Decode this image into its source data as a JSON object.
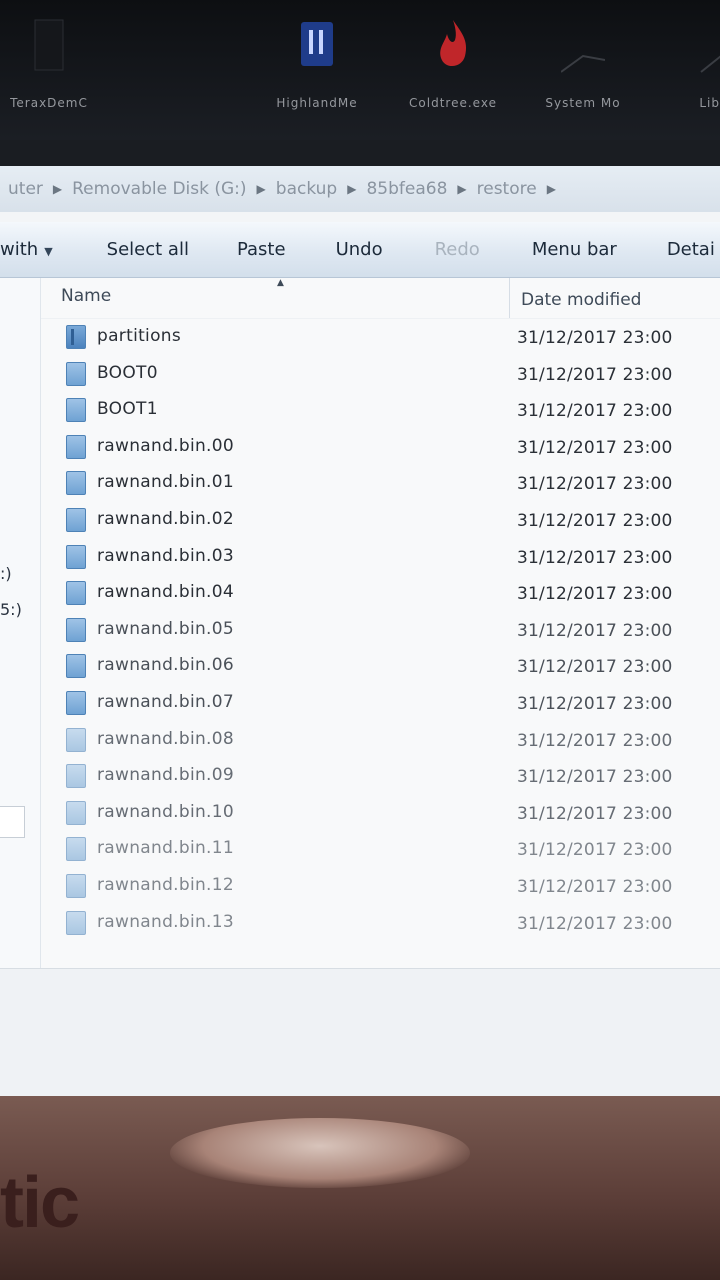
{
  "desktop": {
    "icons": [
      {
        "label": "TeraxDemC",
        "icon": "app-icon"
      },
      {
        "label": "HighlandMe",
        "icon": "app-icon"
      },
      {
        "label": "Coldtree.exe",
        "icon": "flame-icon"
      },
      {
        "label": "System Mo",
        "icon": "app-icon"
      },
      {
        "label": "LibHu",
        "icon": "app-icon"
      }
    ]
  },
  "address": {
    "crumbs": [
      "uter",
      "Removable Disk (G:)",
      "backup",
      "85bfea68",
      "restore"
    ]
  },
  "toolbar": {
    "open_with": "with",
    "select_all": "Select all",
    "paste": "Paste",
    "undo": "Undo",
    "redo": "Redo",
    "menu_bar": "Menu bar",
    "details": "Detai"
  },
  "navpane": {
    "frag1": ":)",
    "frag2": "5:)"
  },
  "list": {
    "columns": {
      "name": "Name",
      "date": "Date modified"
    },
    "files": [
      {
        "name": "partitions",
        "date": "31/12/2017 23:00",
        "type": "folder"
      },
      {
        "name": "BOOT0",
        "date": "31/12/2017 23:00",
        "type": "file"
      },
      {
        "name": "BOOT1",
        "date": "31/12/2017 23:00",
        "type": "file"
      },
      {
        "name": "rawnand.bin.00",
        "date": "31/12/2017 23:00",
        "type": "file"
      },
      {
        "name": "rawnand.bin.01",
        "date": "31/12/2017 23:00",
        "type": "file"
      },
      {
        "name": "rawnand.bin.02",
        "date": "31/12/2017 23:00",
        "type": "file"
      },
      {
        "name": "rawnand.bin.03",
        "date": "31/12/2017 23:00",
        "type": "file"
      },
      {
        "name": "rawnand.bin.04",
        "date": "31/12/2017 23:00",
        "type": "file"
      },
      {
        "name": "rawnand.bin.05",
        "date": "31/12/2017 23:00",
        "type": "file"
      },
      {
        "name": "rawnand.bin.06",
        "date": "31/12/2017 23:00",
        "type": "file"
      },
      {
        "name": "rawnand.bin.07",
        "date": "31/12/2017 23:00",
        "type": "file"
      },
      {
        "name": "rawnand.bin.08",
        "date": "31/12/2017 23:00",
        "type": "file"
      },
      {
        "name": "rawnand.bin.09",
        "date": "31/12/2017 23:00",
        "type": "file"
      },
      {
        "name": "rawnand.bin.10",
        "date": "31/12/2017 23:00",
        "type": "file"
      },
      {
        "name": "rawnand.bin.11",
        "date": "31/12/2017 23:00",
        "type": "file"
      },
      {
        "name": "rawnand.bin.12",
        "date": "31/12/2017 23:00",
        "type": "file"
      },
      {
        "name": "rawnand.bin.13",
        "date": "31/12/2017 23:00",
        "type": "file"
      }
    ]
  },
  "wallpaper": {
    "text": "tic"
  }
}
